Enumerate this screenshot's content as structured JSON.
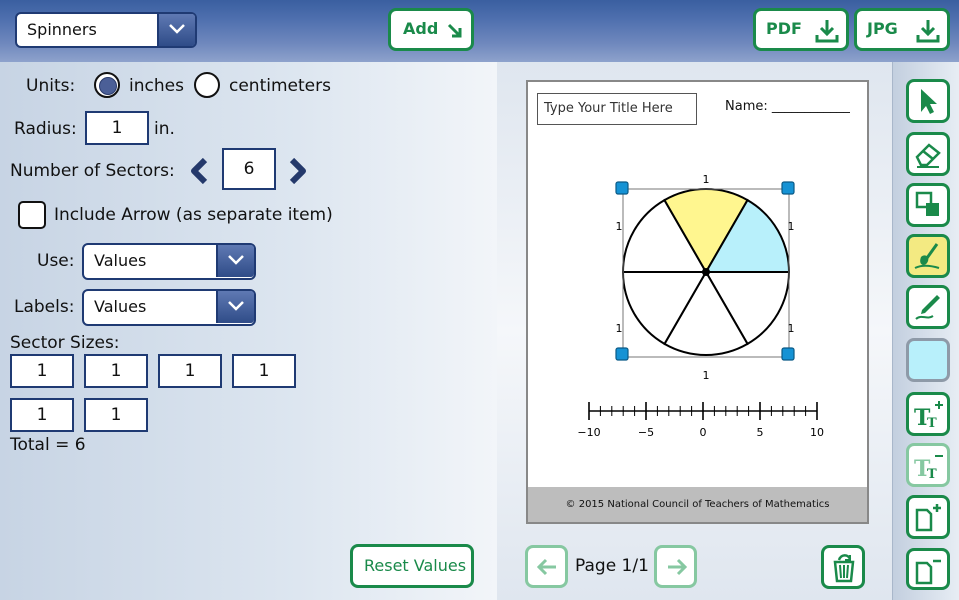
{
  "toolbar": {
    "tool_select": "Spinners",
    "add_label": "Add",
    "pdf_label": "PDF",
    "jpg_label": "JPG"
  },
  "settings": {
    "units_label": "Units:",
    "unit_options": [
      "inches",
      "centimeters"
    ],
    "unit_selected": "inches",
    "radius_label": "Radius:",
    "radius_value": "1",
    "radius_unit": "in.",
    "sectors_label": "Number of Sectors:",
    "sectors_value": "6",
    "include_arrow_label": "Include Arrow (as separate item)",
    "include_arrow_checked": false,
    "use_label": "Use:",
    "use_value": "Values",
    "labels_label": "Labels:",
    "labels_value": "Values",
    "sector_sizes_label": "Sector Sizes:",
    "sector_sizes": [
      "1",
      "1",
      "1",
      "1",
      "1",
      "1"
    ],
    "total_text": "Total = 6",
    "reset_label": "Reset Values"
  },
  "worksheet": {
    "title_placeholder": "Type Your Title Here",
    "name_text": "Name: ____________",
    "spinner": {
      "sector_count": 6,
      "sector_colors": [
        "#ffffff",
        "#fff68f",
        "#b8f0fb",
        "#ffffff",
        "#ffffff",
        "#ffffff"
      ],
      "dimension_labels": [
        "1",
        "1",
        "1",
        "1",
        "1",
        "1"
      ]
    },
    "number_line": {
      "min": -10,
      "max": 10,
      "minor_step": 1,
      "tick_labels": [
        "−10",
        "−5",
        "0",
        "5",
        "10"
      ]
    },
    "copyright": "© 2015 National Council of Teachers of Mathematics"
  },
  "pager": {
    "page_text": "Page 1/1"
  },
  "tools": [
    {
      "icon": "arrow-pointer-icon"
    },
    {
      "icon": "eraser-icon"
    },
    {
      "icon": "layers-icon"
    },
    {
      "icon": "fill-bucket-icon",
      "active": true
    },
    {
      "icon": "pen-icon"
    },
    {
      "icon": "color-swatch-icon",
      "color": "#b8f0fb"
    },
    {
      "icon": "text-size-increase-icon"
    },
    {
      "icon": "text-size-decrease-icon"
    },
    {
      "icon": "add-page-icon"
    },
    {
      "icon": "remove-page-icon"
    }
  ],
  "colors": {
    "accent_green": "#1a8a4a",
    "navy": "#1f3a73",
    "yellow_fill": "#fff68f",
    "cyan_fill": "#b8f0fb",
    "handle_blue": "#1592d4"
  }
}
